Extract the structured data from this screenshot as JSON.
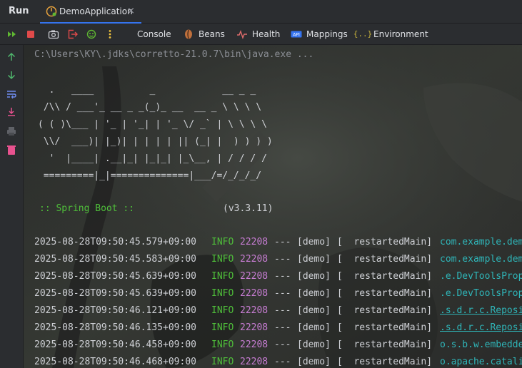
{
  "header": {
    "title": "Run",
    "tab_label": "DemoApplication",
    "close_glyph": "×"
  },
  "toolbar": {
    "icons": [
      "rerun-icon",
      "stop-icon",
      "camera-icon",
      "exit-icon",
      "debug-bug-icon",
      "more-vertical-icon"
    ],
    "tabs": [
      {
        "label": "Console",
        "icon": "console-icon"
      },
      {
        "label": "Beans",
        "icon": "beans-icon"
      },
      {
        "label": "Health",
        "icon": "health-pulse-icon"
      },
      {
        "label": "Mappings",
        "icon": "api-icon",
        "icon_text": "API"
      },
      {
        "label": "Environment",
        "icon": "environment-braces-icon",
        "icon_text": "{..}"
      }
    ],
    "active_tab": "Console"
  },
  "gutter": {
    "icons": [
      "scroll-up-icon",
      "scroll-down-icon",
      "soft-wrap-icon",
      "scroll-to-end-icon",
      "print-icon",
      "clear-trash-icon"
    ]
  },
  "console": {
    "command": "C:\\Users\\KY\\.jdks\\corretto-21.0.7\\bin\\java.exe ...",
    "banner": [
      "  .   ____          _            __ _ _",
      " /\\\\ / ___'_ __ _ _(_)_ __  __ _ \\ \\ \\ \\",
      "( ( )\\___ | '_ | '_| | '_ \\/ _` | \\ \\ \\ \\",
      " \\\\/  ___)| |_)| | | | | || (_| |  ) ) ) )",
      "  '  |____| .__|_| |_|_| |_\\__, | / / / /",
      " =========|_|==============|___/=/_/_/_/"
    ],
    "spring_label": ":: Spring Boot ::",
    "spring_version": "(v3.3.11)",
    "logs": [
      {
        "ts": "2025-08-28T09:50:45.579+09:00",
        "level": "INFO",
        "pid": "22208",
        "sep": "---",
        "app": "[demo]",
        "thread": "[  restartedMain]",
        "logger": "com.example.dem",
        "underline": false
      },
      {
        "ts": "2025-08-28T09:50:45.583+09:00",
        "level": "INFO",
        "pid": "22208",
        "sep": "---",
        "app": "[demo]",
        "thread": "[  restartedMain]",
        "logger": "com.example.dem",
        "underline": false
      },
      {
        "ts": "2025-08-28T09:50:45.639+09:00",
        "level": "INFO",
        "pid": "22208",
        "sep": "---",
        "app": "[demo]",
        "thread": "[  restartedMain]",
        "logger": ".e.DevToolsProp",
        "underline": false
      },
      {
        "ts": "2025-08-28T09:50:45.639+09:00",
        "level": "INFO",
        "pid": "22208",
        "sep": "---",
        "app": "[demo]",
        "thread": "[  restartedMain]",
        "logger": ".e.DevToolsProp",
        "underline": false
      },
      {
        "ts": "2025-08-28T09:50:46.121+09:00",
        "level": "INFO",
        "pid": "22208",
        "sep": "---",
        "app": "[demo]",
        "thread": "[  restartedMain]",
        "logger": ".s.d.r.c.Reposi",
        "underline": true
      },
      {
        "ts": "2025-08-28T09:50:46.135+09:00",
        "level": "INFO",
        "pid": "22208",
        "sep": "---",
        "app": "[demo]",
        "thread": "[  restartedMain]",
        "logger": ".s.d.r.c.Reposi",
        "underline": true
      },
      {
        "ts": "2025-08-28T09:50:46.458+09:00",
        "level": "INFO",
        "pid": "22208",
        "sep": "---",
        "app": "[demo]",
        "thread": "[  restartedMain]",
        "logger": "o.s.b.w.embedde",
        "underline": false
      },
      {
        "ts": "2025-08-28T09:50:46.468+09:00",
        "level": "INFO",
        "pid": "22208",
        "sep": "---",
        "app": "[demo]",
        "thread": "[  restartedMain]",
        "logger": "o.apache.catali",
        "underline": false
      }
    ]
  },
  "colors": {
    "panel_bg": "#2b2d30",
    "accent_blue": "#3574f0",
    "run_green": "#5fb832",
    "stop_red": "#e04a4a",
    "info_green": "#4fbf3a",
    "pid_purple": "#c77dd3",
    "logger_cyan": "#2fb5b8",
    "gutter_green": "#4fb56c",
    "gutter_pink": "#e8528f"
  }
}
